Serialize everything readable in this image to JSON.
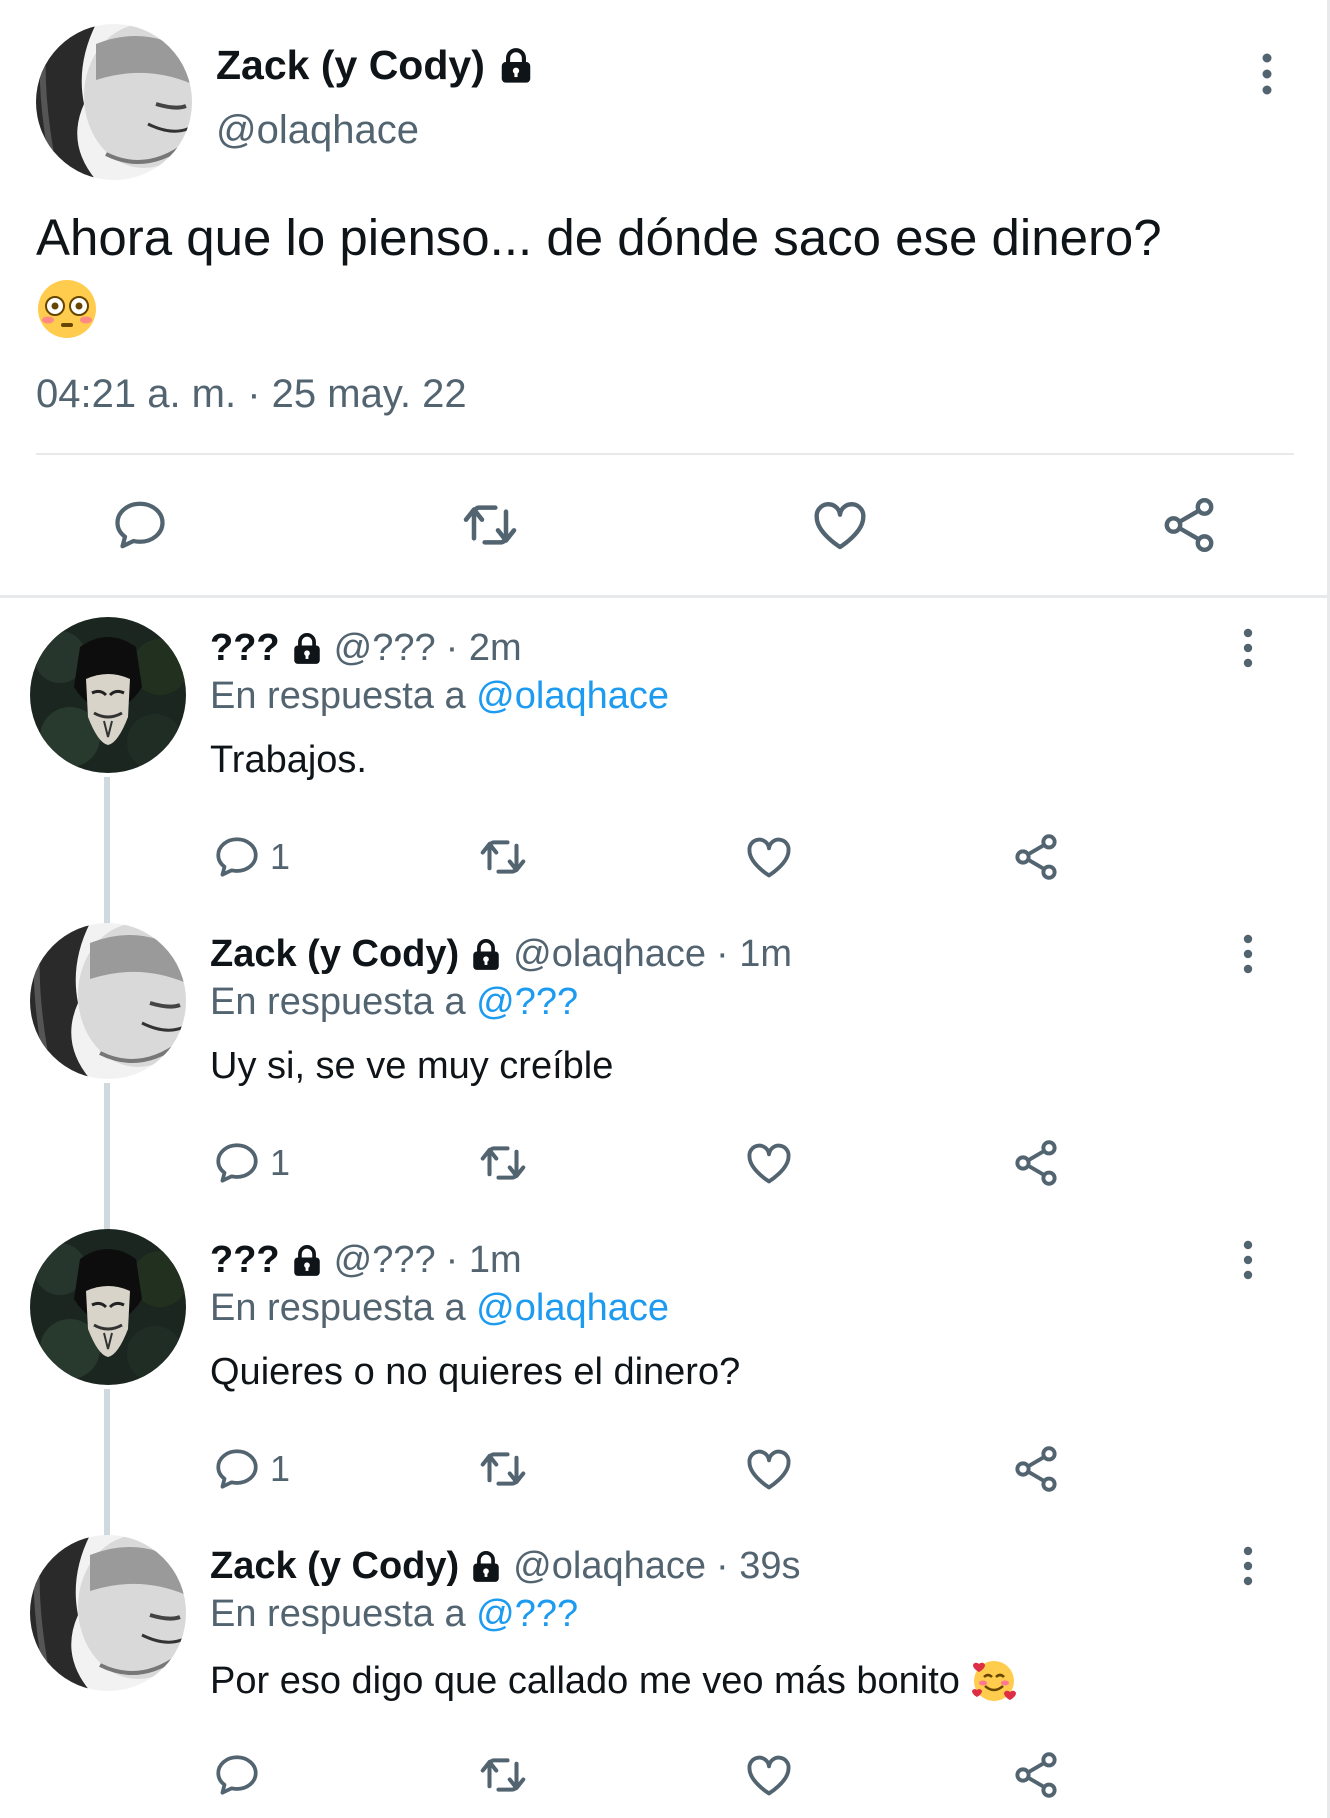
{
  "main_tweet": {
    "display_name": "Zack (y Cody)",
    "handle": "@olaqhace",
    "text": "Ahora que lo pienso... de dónde saco ese dinero?",
    "emoji": "flushed-face",
    "timestamp": "04:21 a. m. · 25 may. 22"
  },
  "replies": [
    {
      "display_name": "???",
      "handle": "@???",
      "age": "· 2m",
      "reply_prefix": "En respuesta a",
      "reply_to": "@olaqhace",
      "text": "Trabajos.",
      "reply_count": "1",
      "avatar": "mask-avatar"
    },
    {
      "display_name": "Zack (y Cody)",
      "handle": "@olaqhace",
      "age": "· 1m",
      "reply_prefix": "En respuesta a",
      "reply_to": "@???",
      "text": "Uy si, se ve muy creíble",
      "reply_count": "1",
      "avatar": "face-avatar"
    },
    {
      "display_name": "???",
      "handle": "@???",
      "age": "· 1m",
      "reply_prefix": "En respuesta a",
      "reply_to": "@olaqhace",
      "text": "Quieres o no quieres el dinero?",
      "reply_count": "1",
      "avatar": "mask-avatar"
    },
    {
      "display_name": "Zack (y Cody)",
      "handle": "@olaqhace",
      "age": "· 39s",
      "reply_prefix": "En respuesta a",
      "reply_to": "@???",
      "text": "Por eso digo que callado me veo más bonito",
      "reply_count": "",
      "avatar": "face-avatar",
      "emoji": "smiling-face-with-hearts"
    }
  ],
  "colors": {
    "text": "#0f1419",
    "secondary": "#536471",
    "mention": "#1d9bf0",
    "divider": "#e7e9ea",
    "thread_line": "#cfd9de"
  }
}
